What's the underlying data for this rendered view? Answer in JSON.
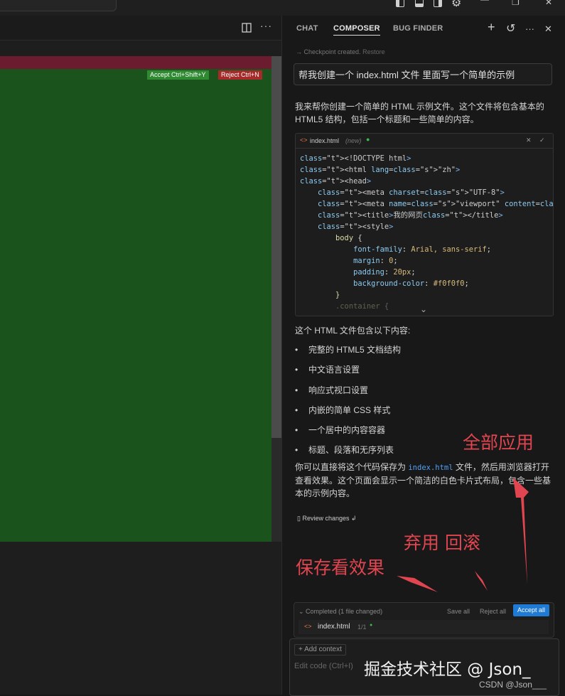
{
  "window": {
    "minimize": "—",
    "restore": "❐",
    "close": "✕"
  },
  "editor": {
    "accept_label": "Accept Ctrl+Shift+Y",
    "reject_label": "Reject Ctrl+N",
    "more_label": "···"
  },
  "panel": {
    "tabs": [
      "CHAT",
      "COMPOSER",
      "BUG FINDER"
    ],
    "icons": {
      "plus": "+",
      "history": "↺",
      "more": "···",
      "close": "✕"
    },
    "checkpoint_text": "Checkpoint created.",
    "restore_label": "Restore",
    "prompt": "帮我创建一个 index.html 文件 里面写一个简单的示例",
    "intro": "我来帮你创建一个简单的 HTML 示例文件。这个文件将包含基本的 HTML5 结构，包括一个标题和一些简单的内容。",
    "code_card": {
      "filename": "index.html",
      "status": "(new)",
      "close": "✕",
      "check": "✓",
      "lines": [
        "<!DOCTYPE html>",
        "<html lang=\"zh\">",
        "<head>",
        "    <meta charset=\"UTF-8\">",
        "    <meta name=\"viewport\" content=\"width=device-width",
        "    <title>我的网页</title>",
        "    <style>",
        "        body {",
        "            font-family: Arial, sans-serif;",
        "            margin: 0;",
        "            padding: 20px;",
        "            background-color: #f0f0f0;",
        "        }",
        "        .container {"
      ]
    },
    "summary": "这个 HTML 文件包含以下内容:",
    "bullets": [
      "完整的 HTML5 文档结构",
      "中文语言设置",
      "响应式视口设置",
      "内嵌的简单 CSS 样式",
      "一个居中的内容容器",
      "标题、段落和无序列表"
    ],
    "explain_before": "你可以直接将这个代码保存为",
    "explain_code": "index.html",
    "explain_after": "文件，然后用浏览器打开查看效果。这个页面会显示一个简洁的白色卡片式布局，包含一些基本的示例内容。",
    "review_changes": "Review changes",
    "completed": "Completed (1 file changed)",
    "save_all": "Save all",
    "reject_all": "Reject all",
    "accept_all": "Accept all",
    "file_row": {
      "name": "index.html",
      "count": "1/1"
    },
    "add_context": "+ Add context",
    "input_placeholder": "Edit code (Ctrl+I)"
  },
  "annotations": {
    "apply_all": "全部应用",
    "discard_rollback": "弃用 回滚",
    "save_view": "保存看效果",
    "watermark": "掘金技术社区 @ Json_",
    "csdn": "CSDN @Json___"
  },
  "colors": {
    "accent": "#1f7ad4",
    "annotation": "#e04550",
    "diff_added": "#1a531c",
    "diff_removed": "#6b1d2f"
  }
}
